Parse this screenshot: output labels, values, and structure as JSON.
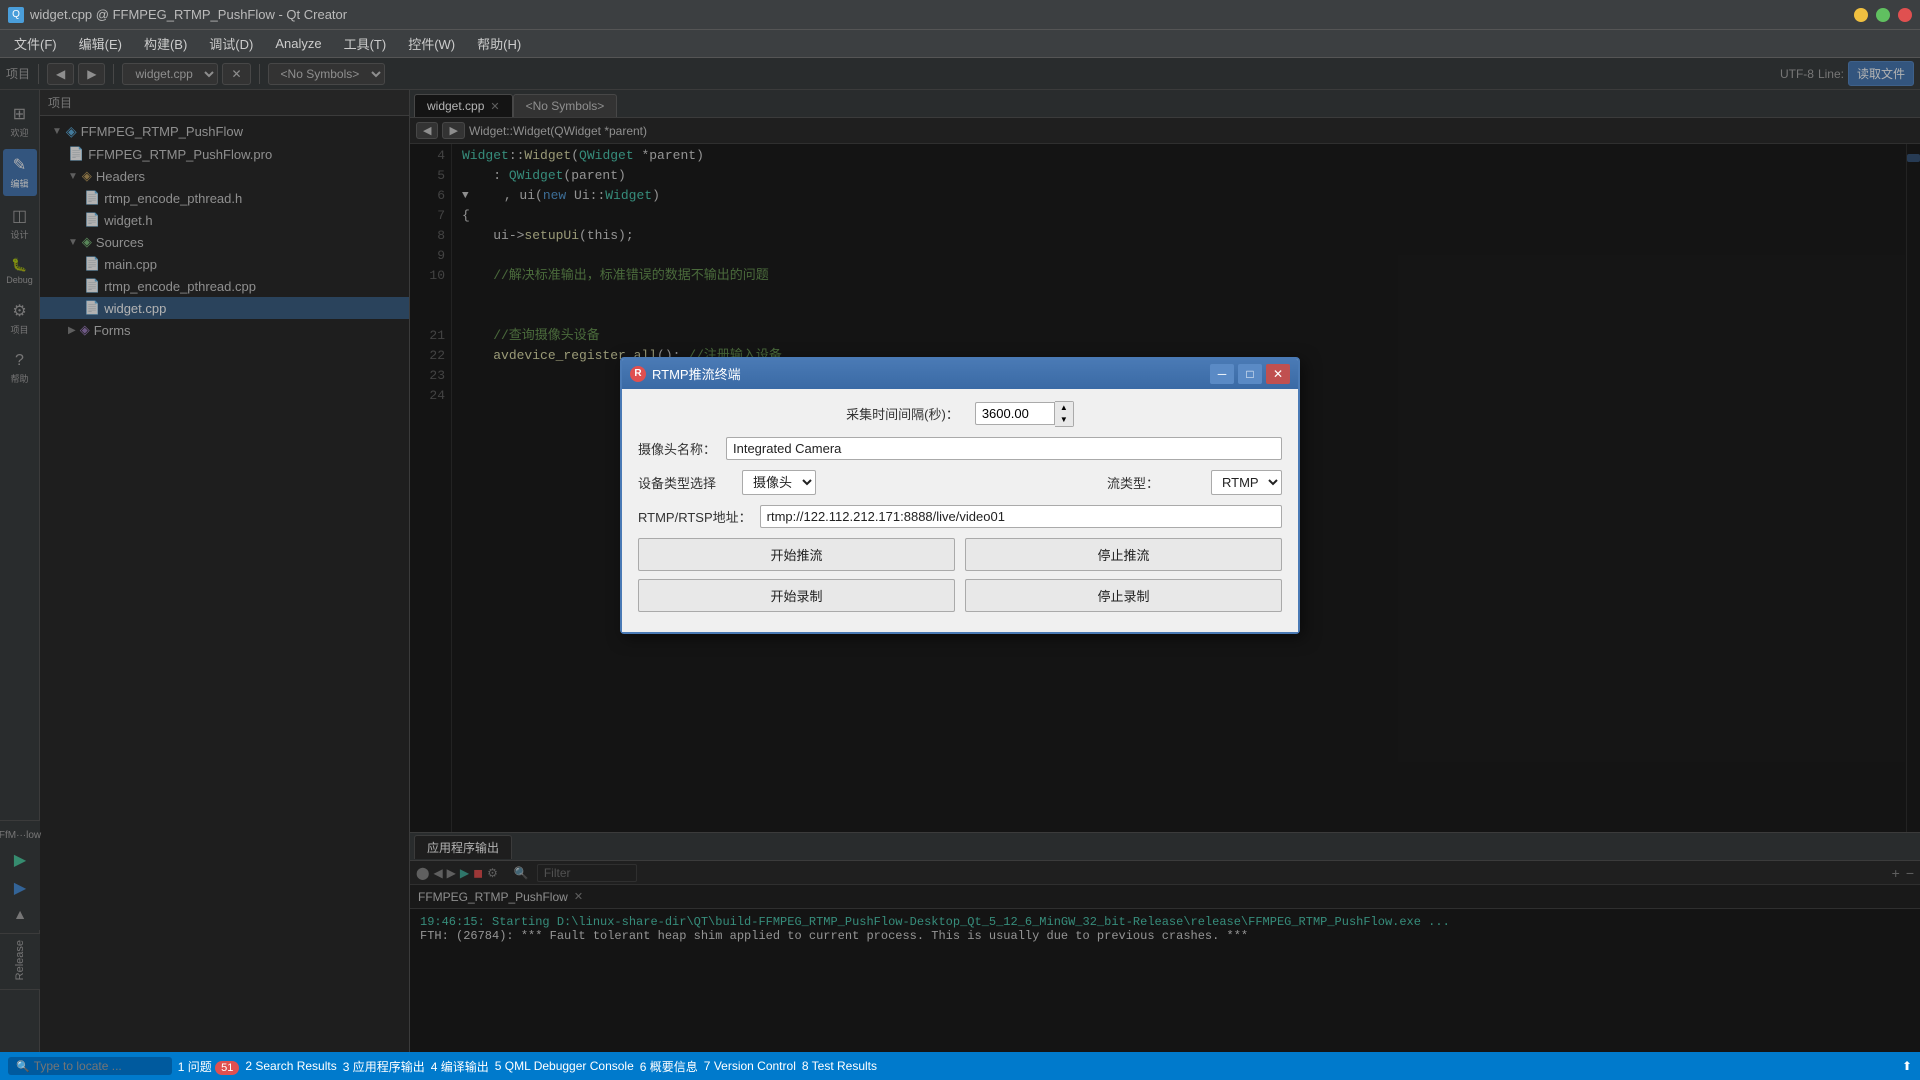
{
  "window": {
    "title": "widget.cpp @ FFMPEG_RTMP_PushFlow - Qt Creator",
    "icon": "Qt"
  },
  "menubar": {
    "items": [
      "文件(F)",
      "编辑(E)",
      "构建(B)",
      "调试(D)",
      "Analyze",
      "工具(T)",
      "控件(W)",
      "帮助(H)"
    ]
  },
  "sidebar": {
    "items": [
      {
        "label": "欢迎",
        "icon": "⊞"
      },
      {
        "label": "编辑",
        "icon": "✎"
      },
      {
        "label": "设计",
        "icon": "◫"
      },
      {
        "label": "Debug",
        "icon": "🐛"
      },
      {
        "label": "项目",
        "icon": "⚙"
      },
      {
        "label": "帮助",
        "icon": "?"
      }
    ]
  },
  "project_panel": {
    "header": "项目",
    "tree": [
      {
        "level": 0,
        "label": "FFMPEG_RTMP_PushFlow",
        "icon": "📁",
        "expanded": true
      },
      {
        "level": 1,
        "label": "FFMPEG_RTMP_PushFlow.pro",
        "icon": "📄",
        "type": "pro"
      },
      {
        "level": 1,
        "label": "Headers",
        "icon": "📁",
        "expanded": true
      },
      {
        "level": 2,
        "label": "rtmp_encode_pthread.h",
        "icon": "📄",
        "type": "h"
      },
      {
        "level": 2,
        "label": "widget.h",
        "icon": "📄",
        "type": "h"
      },
      {
        "level": 1,
        "label": "Sources",
        "icon": "📁",
        "expanded": true
      },
      {
        "level": 2,
        "label": "main.cpp",
        "icon": "📄",
        "type": "cpp"
      },
      {
        "level": 2,
        "label": "rtmp_encode_pthread.cpp",
        "icon": "📄",
        "type": "cpp"
      },
      {
        "level": 2,
        "label": "widget.cpp",
        "icon": "📄",
        "type": "cpp",
        "selected": true
      },
      {
        "level": 1,
        "label": "Forms",
        "icon": "📁",
        "expanded": false
      }
    ]
  },
  "editor": {
    "tabs": [
      {
        "label": "widget.cpp",
        "active": true
      },
      {
        "label": "<No Symbols>",
        "active": false
      }
    ],
    "breadcrumb": "Widget::Widget(QWidget *parent)",
    "encoding": "UTF-8  Line:",
    "lines": [
      {
        "num": 4,
        "content": "Widget::Widget(QWidget *parent)",
        "tokens": [
          {
            "text": "Widget",
            "class": "type"
          },
          {
            "text": "::",
            "class": "op"
          },
          {
            "text": "Widget",
            "class": "func"
          },
          {
            "text": "(",
            "class": "op"
          },
          {
            "text": "QWidget",
            "class": "type"
          },
          {
            "text": " *parent)",
            "class": "op"
          }
        ]
      },
      {
        "num": 5,
        "content": "    : QWidget(parent)",
        "tokens": [
          {
            "text": "    : ",
            "class": ""
          },
          {
            "text": "QWidget",
            "class": "type"
          },
          {
            "text": "(parent)",
            "class": "op"
          }
        ]
      },
      {
        "num": 6,
        "content": "    , ui(new Ui::Widget)",
        "tokens": [
          {
            "text": "    , ui(",
            "class": ""
          },
          {
            "text": "new",
            "class": "kw"
          },
          {
            "text": " Ui::",
            "class": "op"
          },
          {
            "text": "Widget",
            "class": "type"
          },
          {
            "text": ")",
            "class": "op"
          }
        ]
      },
      {
        "num": 7,
        "content": "{",
        "tokens": [
          {
            "text": "{",
            "class": "op"
          }
        ]
      },
      {
        "num": 8,
        "content": "    ui->setupUi(this);",
        "tokens": [
          {
            "text": "    ui",
            "class": ""
          },
          {
            "text": "->",
            "class": "arrow"
          },
          {
            "text": "setupUi",
            "class": "func"
          },
          {
            "text": "(this);",
            "class": "op"
          }
        ]
      },
      {
        "num": 9,
        "content": "",
        "tokens": []
      },
      {
        "num": 10,
        "content": "    //解决标准输出，标准错误的数据不输出的问题",
        "tokens": [
          {
            "text": "    //解决标准输出，标准错误的数据不输出的问题",
            "class": "comment"
          }
        ]
      },
      {
        "num": 21,
        "content": "",
        "tokens": []
      },
      {
        "num": 22,
        "content": "",
        "tokens": []
      },
      {
        "num": 23,
        "content": "    //查询摄像头设备",
        "tokens": [
          {
            "text": "    //查询摄像头设备",
            "class": "comment"
          }
        ]
      },
      {
        "num": 24,
        "content": "    avdevice_register_all(); //注册输入设备",
        "tokens": [
          {
            "text": "    ",
            "class": ""
          },
          {
            "text": "avdevice_register_all",
            "class": "func"
          },
          {
            "text": "(); ",
            "class": "op"
          },
          {
            "text": "//注册输入设备",
            "class": "comment"
          }
        ]
      }
    ]
  },
  "modal": {
    "title": "RTMP推流终端",
    "fields": {
      "capture_interval_label": "采集时间间隔(秒)：",
      "capture_interval_value": "3600.00",
      "camera_name_label": "摄像头名称：",
      "camera_name_value": "Integrated Camera",
      "device_type_label": "设备类型选择",
      "device_type_value": "摄像头",
      "stream_type_label": "流类型：",
      "stream_type_value": "RTMP",
      "rtmp_label": "RTMP/RTSP地址：",
      "rtmp_value": "rtmp://122.112.212.171:8888/live/video01"
    },
    "buttons": {
      "start_push": "开始推流",
      "stop_push": "停止推流",
      "start_record": "开始录制",
      "stop_record": "停止录制"
    }
  },
  "bottom_panel": {
    "tab_label": "应用程序输出",
    "subtab": "FFMPEG_RTMP_PushFlow",
    "output_lines": [
      "19:46:15: Starting D:\\linux-share-dir\\QT\\build-FFMPEG_RTMP_PushFlow-Desktop_Qt_5_12_6_MinGW_32_bit-Release\\release\\FFMPEG_RTMP_PushFlow.exe ...",
      "FTH: (26784): *** Fault tolerant heap shim applied to current process. This is usually due to previous crashes. ***"
    ]
  },
  "status_bar": {
    "search_placeholder": "Type to locate ...",
    "tabs": [
      {
        "num": "1",
        "label": "问题",
        "badge": "51"
      },
      {
        "num": "2",
        "label": "Search Results"
      },
      {
        "num": "3",
        "label": "应用程序输出"
      },
      {
        "num": "4",
        "label": "编译输出"
      },
      {
        "num": "5",
        "label": "QML Debugger Console"
      },
      {
        "num": "6",
        "label": "概要信息"
      },
      {
        "num": "7",
        "label": "Version Control"
      },
      {
        "num": "8",
        "label": "Test Results"
      }
    ],
    "encoding": "UTF-8",
    "line_info": "Line:"
  },
  "release_section": {
    "buttons": [
      {
        "label": "▶",
        "title": "run"
      },
      {
        "label": "▶",
        "title": "debug"
      },
      {
        "label": "◼",
        "title": "stop"
      }
    ],
    "kit_label": "FfM···low",
    "config_label": "Release"
  }
}
